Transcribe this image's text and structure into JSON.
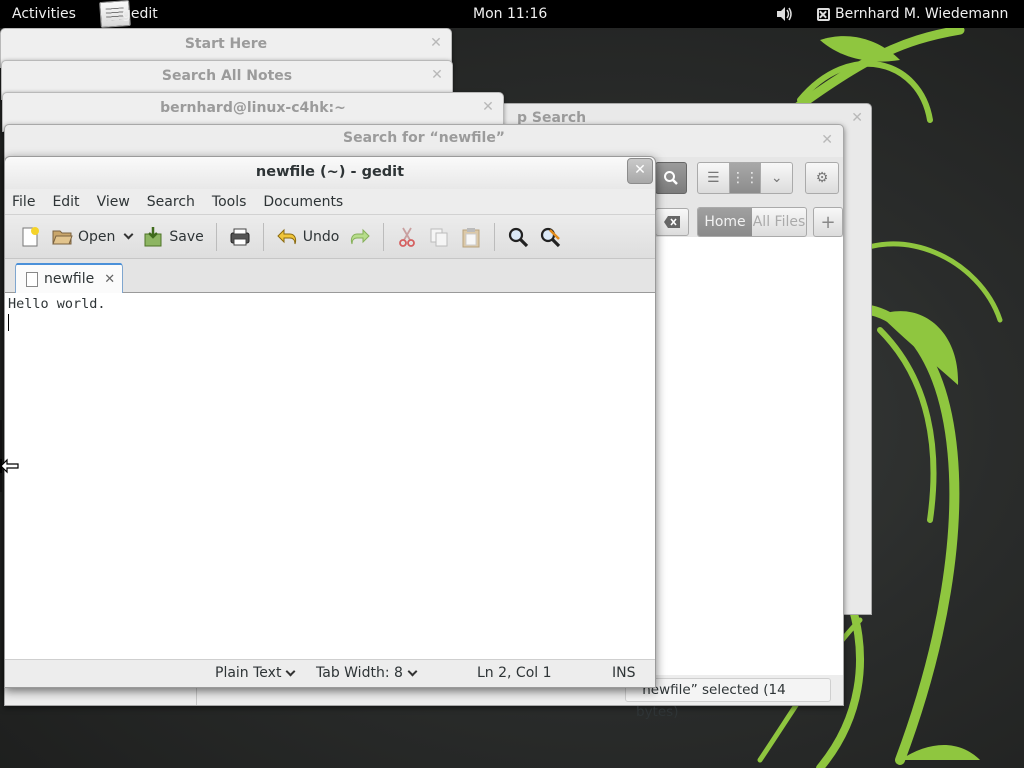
{
  "topbar": {
    "activities": "Activities",
    "app_name": "gedit",
    "clock": "Mon 11:16",
    "user": "Bernhard M. Wiedemann"
  },
  "background_windows": {
    "start_here": "Start Here",
    "search_all_notes": "Search All Notes",
    "terminal": "bernhard@linux-c4hk:~",
    "desktop_search_partial": "p Search",
    "search_for": "Search for “newfile”"
  },
  "nautilus": {
    "location_home": "Home",
    "location_all_files": "All Files",
    "status": "“newfile” selected  (14 bytes)"
  },
  "gedit": {
    "title": "newfile (~) - gedit",
    "menu": [
      "File",
      "Edit",
      "View",
      "Search",
      "Tools",
      "Documents"
    ],
    "toolbar": {
      "open_label": "Open",
      "save_label": "Save",
      "undo_label": "Undo"
    },
    "tab_label": "newfile",
    "content_line1": "Hello world.",
    "statusbar": {
      "language": "Plain Text",
      "tab_width": "Tab Width: 8",
      "position": "Ln 2, Col 1",
      "mode": "INS"
    }
  },
  "colors": {
    "accent_tab": "#4a90d9",
    "wallpaper_leaf": "#8fc63f",
    "topbar": "#000000"
  }
}
